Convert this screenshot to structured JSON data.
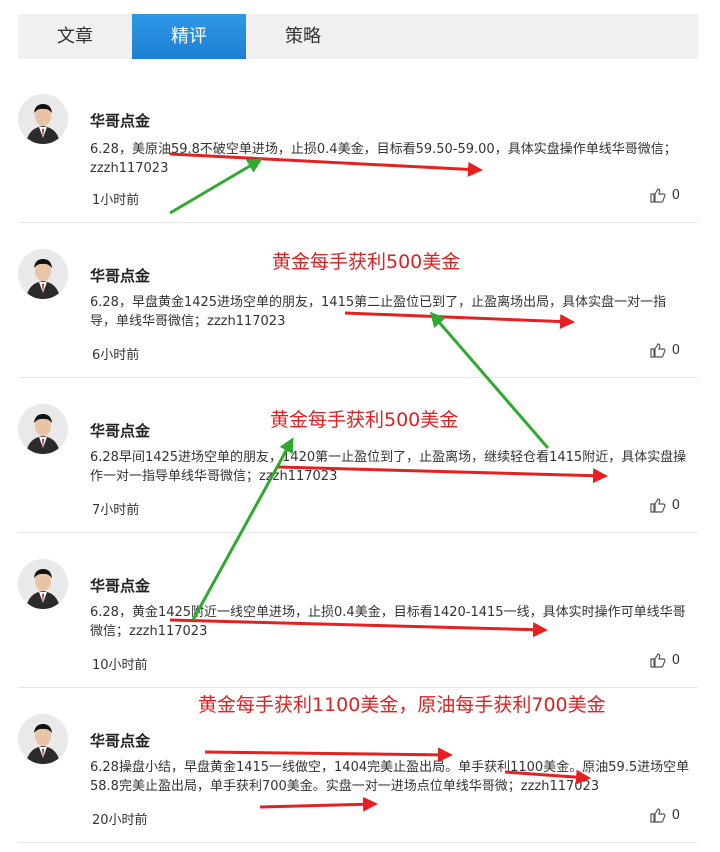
{
  "tabs": [
    {
      "label": "文章",
      "active": false
    },
    {
      "label": "精评",
      "active": true
    },
    {
      "label": "策略",
      "active": false
    }
  ],
  "posts": [
    {
      "author": "华哥点金",
      "content": "6.28，美原油59.8不破空单进场，止损0.4美金，目标看59.50-59.00，具体实盘操作单线华哥微信；zzzh117023",
      "time": "1小时前",
      "likes": "0"
    },
    {
      "author": "华哥点金",
      "content": "6.28，早盘黄金1425进场空单的朋友，1415第二止盈位已到了，止盈离场出局，具体实盘一对一指导，单线华哥微信；zzzh117023",
      "time": "6小时前",
      "likes": "0"
    },
    {
      "author": "华哥点金",
      "content": "6.28早间1425进场空单的朋友，1420第一止盈位到了，止盈离场，继续轻仓看1415附近，具体实盘操作一对一指导单线华哥微信；zzzh117023",
      "time": "7小时前",
      "likes": "0"
    },
    {
      "author": "华哥点金",
      "content": "6.28，黄金1425附近一线空单进场，止损0.4美金，目标看1420-1415一线，具体实时操作可单线华哥微信；zzzh117023",
      "time": "10小时前",
      "likes": "0"
    },
    {
      "author": "华哥点金",
      "content": "6.28操盘小结，早盘黄金1415一线做空，1404完美止盈出局。单手获利1100美金。原油59.5进场空单58.8完美止盈出局，单手获利700美金。实盘一对一进场点位单线华哥微；zzzh117023",
      "time": "20小时前",
      "likes": "0"
    }
  ],
  "annotations": [
    {
      "text": "黄金每手获利500美金"
    },
    {
      "text": "黄金每手获利500美金"
    },
    {
      "text": "黄金每手获利1100美金，原油每手获利700美金"
    }
  ],
  "colors": {
    "accent": "#1e88dc",
    "annotation": "#e02020",
    "arrow_red": "#e62020",
    "arrow_green": "#2eaa2e"
  },
  "icons": {
    "like": "thumbs-up-icon",
    "avatar": "person-in-suit"
  }
}
